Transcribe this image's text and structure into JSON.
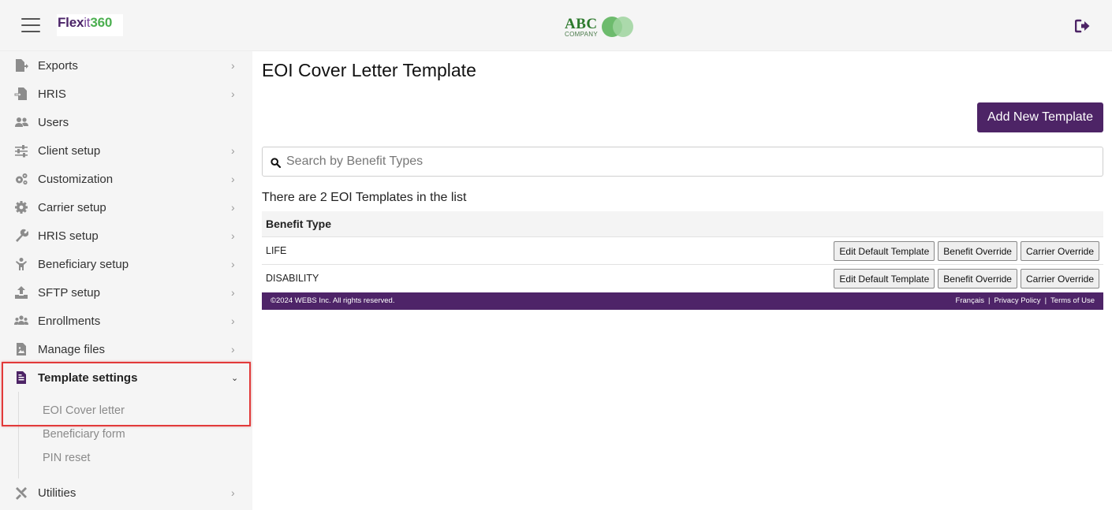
{
  "header": {
    "brand": {
      "part1": "Flex",
      "part2": "it",
      "part3": "360"
    },
    "client_logo": {
      "name": "ABC",
      "sub": "COMPANY"
    },
    "logout_icon": "logout-icon"
  },
  "sidebar": {
    "items": [
      {
        "label": "Exports",
        "icon": "export-icon"
      },
      {
        "label": "HRIS",
        "icon": "import-icon"
      },
      {
        "label": "Users",
        "icon": "users-icon"
      },
      {
        "label": "Client setup",
        "icon": "sliders-icon"
      },
      {
        "label": "Customization",
        "icon": "cogs-icon"
      },
      {
        "label": "Carrier setup",
        "icon": "gear-icon"
      },
      {
        "label": "HRIS setup",
        "icon": "wrench-icon"
      },
      {
        "label": "Beneficiary setup",
        "icon": "child-icon"
      },
      {
        "label": "SFTP setup",
        "icon": "upload-icon"
      },
      {
        "label": "Enrollments",
        "icon": "user-group-icon"
      },
      {
        "label": "Manage files",
        "icon": "image-file-icon"
      },
      {
        "label": "Template settings",
        "icon": "document-icon"
      },
      {
        "label": "Utilities",
        "icon": "tools-icon"
      }
    ],
    "sub_items": [
      {
        "label": "EOI Cover letter"
      },
      {
        "label": "Beneficiary form"
      },
      {
        "label": "PIN reset"
      }
    ]
  },
  "main": {
    "title": "EOI Cover Letter Template",
    "add_button": "Add New Template",
    "search_placeholder": "Search by Benefit Types",
    "count_text": "There are 2 EOI Templates in the list",
    "table": {
      "header": "Benefit Type",
      "rows": [
        {
          "type": "LIFE",
          "actions": [
            "Edit Default Template",
            "Benefit Override",
            "Carrier Override"
          ]
        },
        {
          "type": "DISABILITY",
          "actions": [
            "Edit Default Template",
            "Benefit Override",
            "Carrier Override"
          ]
        }
      ]
    }
  },
  "footer": {
    "copyright": "©2024 WEBS Inc. All rights reserved.",
    "links": [
      "Français",
      "Privacy Policy",
      "Terms of Use"
    ]
  },
  "colors": {
    "brand_purple": "#4d2466",
    "brand_green": "#4caf50",
    "highlight_red": "#e23a3a"
  }
}
